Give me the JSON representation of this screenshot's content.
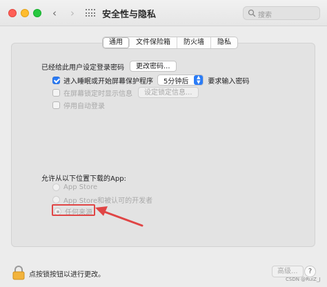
{
  "window": {
    "title": "安全性与隐私",
    "search_placeholder": "搜索"
  },
  "tabs": [
    {
      "label": "通用",
      "selected": true
    },
    {
      "label": "文件保险箱",
      "selected": false
    },
    {
      "label": "防火墙",
      "selected": false
    },
    {
      "label": "隐私",
      "selected": false
    }
  ],
  "general": {
    "password_label": "已经给此用户设定登录密码",
    "change_password_button": "更改密码...",
    "require_password": {
      "checked": true,
      "prefix": "进入睡眠或开始屏幕保护程序",
      "select_value": "5分钟后",
      "suffix": "要求输入密码"
    },
    "lock_message": {
      "checked": false,
      "label": "在屏幕锁定时显示信息",
      "button": "设定锁定信息..."
    },
    "disable_auto_login": {
      "checked": false,
      "label": "停用自动登录"
    }
  },
  "downloads": {
    "title": "允许从以下位置下载的App:",
    "options": [
      {
        "label": "App Store",
        "selected": false
      },
      {
        "label": "App Store和被认可的开发者",
        "selected": false
      },
      {
        "label": "任何来源",
        "selected": true
      }
    ]
  },
  "footer": {
    "lock_text": "点按锁按钮以进行更改。",
    "advanced_button": "高级...",
    "help_button": "?",
    "watermark": "CSDN @RuiZ_J"
  },
  "colors": {
    "accent": "#2b7cf6",
    "annotation": "#e04545"
  }
}
